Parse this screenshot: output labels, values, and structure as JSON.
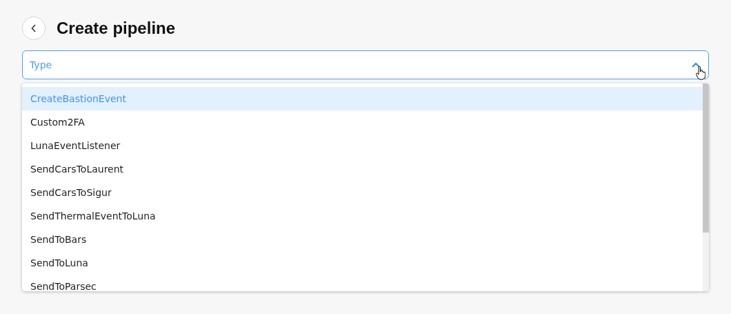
{
  "header": {
    "title": "Create pipeline"
  },
  "type_field": {
    "placeholder": "Type",
    "expanded": true
  },
  "options": [
    {
      "label": "CreateBastionEvent",
      "selected": true
    },
    {
      "label": "Custom2FA",
      "selected": false
    },
    {
      "label": "LunaEventListener",
      "selected": false
    },
    {
      "label": "SendCarsToLaurent",
      "selected": false
    },
    {
      "label": "SendCarsToSigur",
      "selected": false
    },
    {
      "label": "SendThermalEventToLuna",
      "selected": false
    },
    {
      "label": "SendToBars",
      "selected": false
    },
    {
      "label": "SendToLuna",
      "selected": false
    },
    {
      "label": "SendToParsec",
      "selected": false
    }
  ]
}
